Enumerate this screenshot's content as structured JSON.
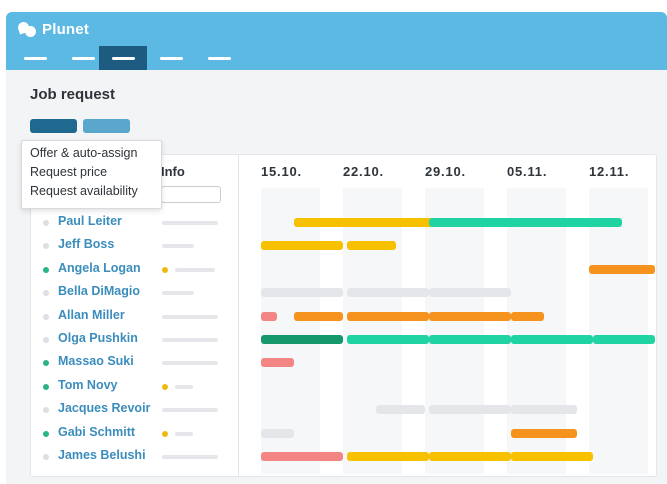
{
  "app": {
    "name": "Plunet"
  },
  "nav": {
    "items": [
      "menu-1",
      "menu-2",
      "menu-3",
      "menu-4",
      "menu-5"
    ],
    "active_index": 2
  },
  "page": {
    "title": "Job request"
  },
  "actions": {
    "dark_button": "",
    "light_button": ""
  },
  "dropdown": {
    "items": [
      "Offer & auto-assign",
      "Request price",
      "Request availability"
    ]
  },
  "grid": {
    "info_label": "Info",
    "dates": [
      "15.10.",
      "22.10.",
      "29.10.",
      "05.11.",
      "12.11."
    ],
    "colors": {
      "yellow": "#f8c100",
      "green": "#1fd3a2",
      "orange": "#f5931e",
      "red": "#f48585",
      "darkgreen": "#16986c",
      "gray": "#e4e6ea"
    },
    "rows": [
      {
        "name": "Paul Leiter",
        "active": false,
        "status": false,
        "info_width": 56,
        "bars": [
          {
            "color": "yellow",
            "start": 1.4,
            "end": 2.1
          },
          {
            "color": "yellow",
            "start": 2.05,
            "end": 3.1
          },
          {
            "color": "green",
            "start": 3.05,
            "end": 4.1
          },
          {
            "color": "green",
            "start": 4.05,
            "end": 5.1
          },
          {
            "color": "green",
            "start": 5.05,
            "end": 5.4
          }
        ]
      },
      {
        "name": "Jeff Boss",
        "active": false,
        "status": false,
        "info_width": 32,
        "bars": [
          {
            "color": "yellow",
            "start": 1.0,
            "end": 2.0
          },
          {
            "color": "yellow",
            "start": 2.05,
            "end": 2.65
          }
        ]
      },
      {
        "name": "Angela Logan",
        "active": true,
        "status": true,
        "info_width": 40,
        "bars": [
          {
            "color": "orange",
            "start": 5.0,
            "end": 5.8
          }
        ]
      },
      {
        "name": "Bella DiMagio",
        "active": false,
        "status": false,
        "info_width": 32,
        "bars": [
          {
            "color": "gray",
            "start": 1.0,
            "end": 2.0
          },
          {
            "color": "gray",
            "start": 2.05,
            "end": 3.05
          },
          {
            "color": "gray",
            "start": 3.05,
            "end": 4.05
          }
        ]
      },
      {
        "name": "Allan Miller",
        "active": false,
        "status": false,
        "info_width": 56,
        "bars": [
          {
            "color": "red",
            "start": 1.0,
            "end": 1.2
          },
          {
            "color": "orange",
            "start": 1.4,
            "end": 2.0
          },
          {
            "color": "orange",
            "start": 2.05,
            "end": 3.05
          },
          {
            "color": "orange",
            "start": 3.05,
            "end": 4.05
          },
          {
            "color": "orange",
            "start": 4.05,
            "end": 4.45
          }
        ]
      },
      {
        "name": "Olga Pushkin",
        "active": false,
        "status": false,
        "info_width": 56,
        "bars": [
          {
            "color": "darkgreen",
            "start": 1.0,
            "end": 2.0
          },
          {
            "color": "green",
            "start": 2.05,
            "end": 3.05
          },
          {
            "color": "green",
            "start": 3.05,
            "end": 4.05
          },
          {
            "color": "green",
            "start": 4.05,
            "end": 5.05
          },
          {
            "color": "green",
            "start": 5.05,
            "end": 6.0
          }
        ]
      },
      {
        "name": "Massao Suki",
        "active": true,
        "status": false,
        "info_width": 56,
        "bars": [
          {
            "color": "red",
            "start": 1.0,
            "end": 1.4
          }
        ]
      },
      {
        "name": "Tom Novy",
        "active": true,
        "status": true,
        "info_width": 18,
        "bars": []
      },
      {
        "name": "Jacques Revoir",
        "active": false,
        "status": false,
        "info_width": 56,
        "bars": [
          {
            "color": "gray",
            "start": 2.4,
            "end": 3.0
          },
          {
            "color": "gray",
            "start": 3.05,
            "end": 4.05
          },
          {
            "color": "gray",
            "start": 4.05,
            "end": 4.85
          }
        ]
      },
      {
        "name": "Gabi Schmitt",
        "active": true,
        "status": true,
        "info_width": 18,
        "bars": [
          {
            "color": "gray",
            "start": 1.0,
            "end": 1.4
          },
          {
            "color": "orange",
            "start": 4.05,
            "end": 4.85
          }
        ]
      },
      {
        "name": "James Belushi",
        "active": false,
        "status": false,
        "info_width": 56,
        "bars": [
          {
            "color": "red",
            "start": 1.0,
            "end": 2.0
          },
          {
            "color": "yellow",
            "start": 2.05,
            "end": 3.05
          },
          {
            "color": "yellow",
            "start": 3.05,
            "end": 4.05
          },
          {
            "color": "yellow",
            "start": 4.05,
            "end": 5.05
          }
        ]
      }
    ]
  }
}
